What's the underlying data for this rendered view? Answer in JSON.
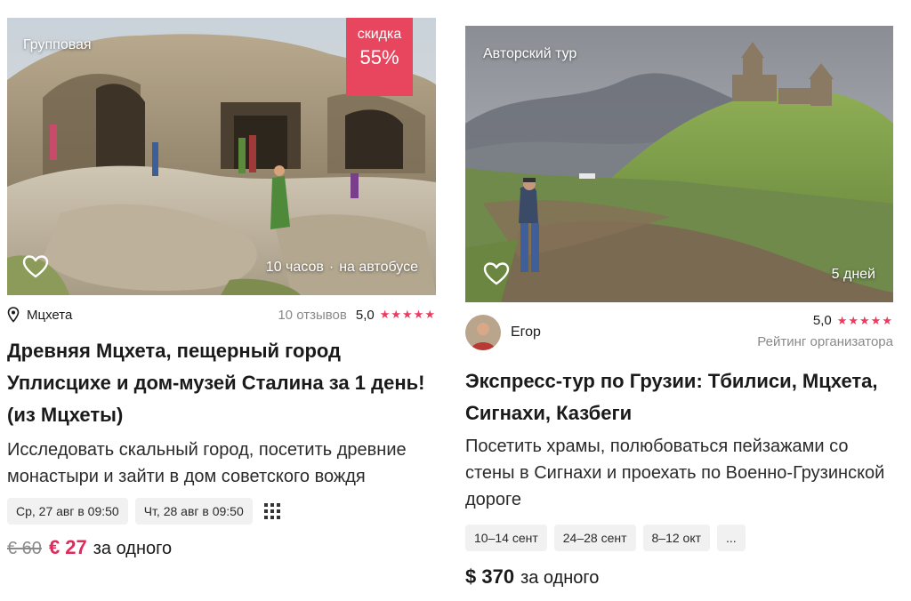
{
  "cards": [
    {
      "type_label": "Групповая",
      "discount": {
        "label": "скидка",
        "value": "55%"
      },
      "duration": "10 часов",
      "separator": "·",
      "transport": "на автобусе",
      "location": "Мцхета",
      "reviews": "10 отзывов",
      "rating": "5,0",
      "stars": "★★★★★",
      "title": "Древняя Мцхета, пещерный город Уплисцихе и дом-музей Сталина за 1 день! (из Мцхеты)",
      "description": "Исследовать скальный город, посетить древние монастыри и зайти в дом советского вождя",
      "dates": [
        "Ср, 27 авг в 09:50",
        "Чт, 28 авг в 09:50"
      ],
      "old_price": "€ 60",
      "price": "€ 27",
      "per": "за одного"
    },
    {
      "type_label": "Авторский тур",
      "duration": "5 дней",
      "organizer": {
        "name": "Егор",
        "rating": "5,0",
        "stars": "★★★★★",
        "rating_label": "Рейтинг организатора"
      },
      "title": "Экспресс-тур по Грузии: Тбилиси, Мцхета, Сигнахи, Казбеги",
      "description": "Посетить храмы, полюбоваться пейзажами со стены в Сигнахи и проехать по Военно-Грузинской дороге",
      "dates": [
        "10–14 сент",
        "24–28 сент",
        "8–12 окт",
        "..."
      ],
      "price": "$ 370",
      "per": "за одного"
    }
  ],
  "icons": {
    "favorite": "heart-icon",
    "location": "map-pin-icon",
    "calendar_more": "grid-icon"
  },
  "colors": {
    "accent": "#e22a5a",
    "star": "#ee3a5e",
    "discount_bg": "#e8465f",
    "chip_bg": "#f1f1f1",
    "muted": "#8a8a8a"
  }
}
